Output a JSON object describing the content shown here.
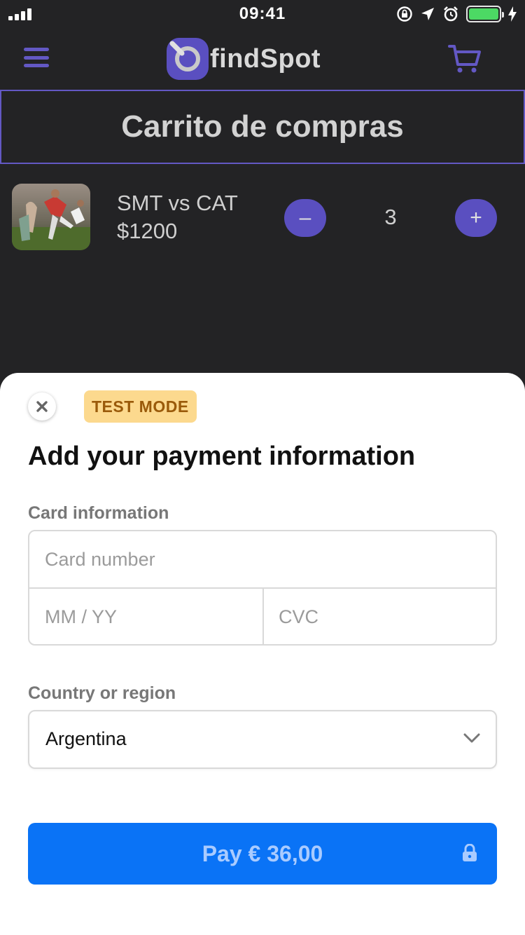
{
  "status_bar": {
    "time": "09:41",
    "battery_level": 1.0
  },
  "app": {
    "logo_text": "findSpot",
    "brand_color": "#5a4fc0"
  },
  "page": {
    "title": "Carrito de compras"
  },
  "cart": {
    "items": [
      {
        "name": "SMT vs CAT",
        "price": "$1200",
        "quantity": "3",
        "minus_label": "–",
        "plus_label": "+"
      }
    ]
  },
  "payment": {
    "test_badge": "TEST MODE",
    "title": "Add your payment information",
    "card_label": "Card information",
    "card_number_placeholder": "Card number",
    "expiry_placeholder": "MM / YY",
    "cvc_placeholder": "CVC",
    "country_label": "Country or region",
    "country_value": "Argentina",
    "pay_button_label": "Pay € 36,00",
    "pay_button_color": "#0a73f6"
  }
}
